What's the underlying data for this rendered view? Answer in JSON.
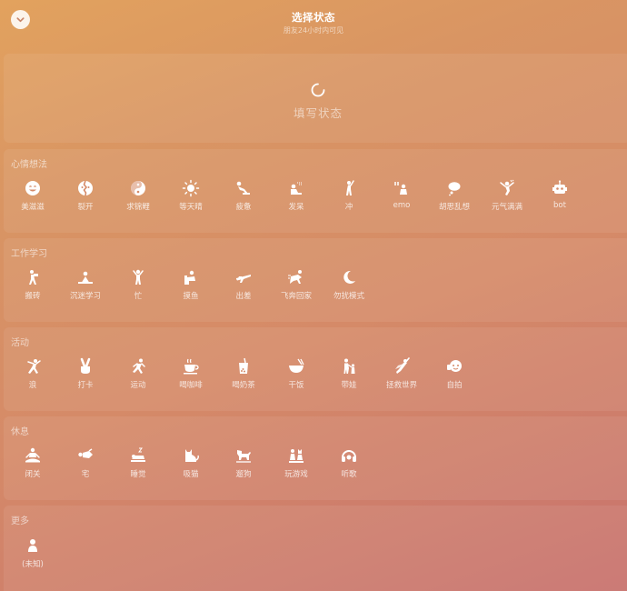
{
  "header": {
    "title": "选择状态",
    "subtitle": "朋友24小时内可见",
    "collapse_icon": "chevron-down-icon"
  },
  "status_input": {
    "placeholder": "填写状态",
    "icon": "spinner-icon"
  },
  "sections": [
    {
      "title": "心情想法",
      "items": [
        {
          "label": "美滋滋",
          "icon": "smile-face-icon"
        },
        {
          "label": "裂开",
          "icon": "cracked-face-icon"
        },
        {
          "label": "求锦鲤",
          "icon": "koi-fish-icon"
        },
        {
          "label": "等天晴",
          "icon": "sun-icon"
        },
        {
          "label": "疲惫",
          "icon": "exhausted-figure-icon"
        },
        {
          "label": "发呆",
          "icon": "daydream-figure-icon"
        },
        {
          "label": "冲",
          "icon": "charge-figure-icon"
        },
        {
          "label": "emo",
          "icon": "emo-figure-icon"
        },
        {
          "label": "胡思乱想",
          "icon": "thought-bubble-icon"
        },
        {
          "label": "元气满满",
          "icon": "energetic-figure-icon"
        },
        {
          "label": "bot",
          "icon": "robot-icon"
        }
      ]
    },
    {
      "title": "工作学习",
      "items": [
        {
          "label": "搬砖",
          "icon": "brick-carrying-icon"
        },
        {
          "label": "沉迷学习",
          "icon": "studying-figure-icon"
        },
        {
          "label": "忙",
          "icon": "busy-figure-icon"
        },
        {
          "label": "摸鱼",
          "icon": "slacking-figure-icon"
        },
        {
          "label": "出差",
          "icon": "airplane-icon"
        },
        {
          "label": "飞奔回家",
          "icon": "running-home-icon"
        },
        {
          "label": "勿扰模式",
          "icon": "moon-icon"
        }
      ]
    },
    {
      "title": "活动",
      "items": [
        {
          "label": "浪",
          "icon": "dancing-figure-icon"
        },
        {
          "label": "打卡",
          "icon": "peace-hand-icon"
        },
        {
          "label": "运动",
          "icon": "running-figure-icon"
        },
        {
          "label": "喝咖啡",
          "icon": "coffee-cup-icon"
        },
        {
          "label": "喝奶茶",
          "icon": "bubble-tea-icon"
        },
        {
          "label": "干饭",
          "icon": "rice-bowl-icon"
        },
        {
          "label": "带娃",
          "icon": "parent-child-icon"
        },
        {
          "label": "拯救世界",
          "icon": "superhero-icon"
        },
        {
          "label": "自拍",
          "icon": "selfie-icon"
        }
      ]
    },
    {
      "title": "休息",
      "items": [
        {
          "label": "闭关",
          "icon": "meditation-icon"
        },
        {
          "label": "宅",
          "icon": "lying-figure-icon"
        },
        {
          "label": "睡觉",
          "icon": "sleeping-figure-icon"
        },
        {
          "label": "吸猫",
          "icon": "cat-icon"
        },
        {
          "label": "遛狗",
          "icon": "dog-walking-icon"
        },
        {
          "label": "玩游戏",
          "icon": "game-pieces-icon"
        },
        {
          "label": "听歌",
          "icon": "headphones-icon"
        }
      ]
    },
    {
      "title": "更多",
      "items": [
        {
          "label": "(未知)",
          "icon": "unknown-person-icon"
        }
      ]
    }
  ]
}
